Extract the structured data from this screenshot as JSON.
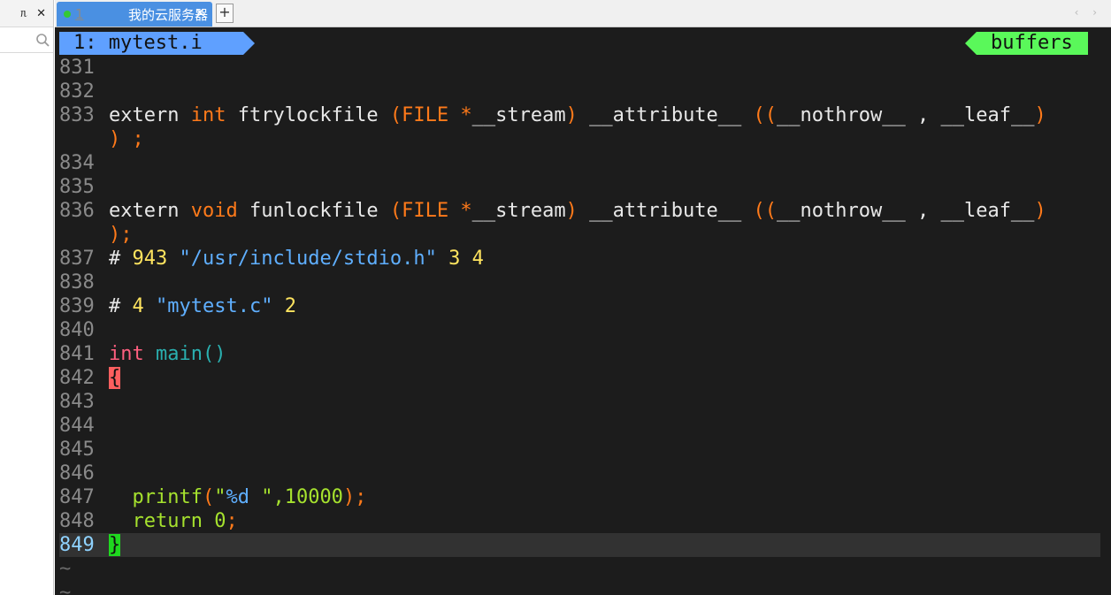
{
  "left_panel": {
    "pin_glyph": "ᥰ",
    "close_glyph": "✕",
    "search_icon": "magnifier-icon"
  },
  "tabbar": {
    "tab": {
      "number": "1",
      "title": "我的云服务器",
      "close": "✕"
    },
    "add": "+",
    "nav": "‹ ›"
  },
  "vim": {
    "tabline_left": "1: mytest.i",
    "tabline_right": "buffers",
    "lines": [
      {
        "n": "831",
        "text": ""
      },
      {
        "n": "832",
        "text": ""
      },
      {
        "n": "833",
        "text": "extern int ftrylockfile (FILE *__stream) __attribute__ ((__nothrow__ , __leaf__)"
      },
      {
        "n": "",
        "text": ") ;"
      },
      {
        "n": "834",
        "text": ""
      },
      {
        "n": "835",
        "text": ""
      },
      {
        "n": "836",
        "text": "extern void funlockfile (FILE *__stream) __attribute__ ((__nothrow__ , __leaf__)"
      },
      {
        "n": "",
        "text": ");"
      },
      {
        "n": "837",
        "text": "# 943 \"/usr/include/stdio.h\" 3 4"
      },
      {
        "n": "838",
        "text": ""
      },
      {
        "n": "839",
        "text": "# 4 \"mytest.c\" 2"
      },
      {
        "n": "840",
        "text": ""
      },
      {
        "n": "841",
        "text": "int main()"
      },
      {
        "n": "842",
        "text": "{"
      },
      {
        "n": "843",
        "text": ""
      },
      {
        "n": "844",
        "text": ""
      },
      {
        "n": "845",
        "text": ""
      },
      {
        "n": "846",
        "text": ""
      },
      {
        "n": "847",
        "text": "  printf(\"%d \",10000);"
      },
      {
        "n": "848",
        "text": "  return 0;"
      },
      {
        "n": "849",
        "text": "}"
      },
      {
        "n": "~",
        "text": ""
      },
      {
        "n": "~",
        "text": ""
      }
    ]
  }
}
